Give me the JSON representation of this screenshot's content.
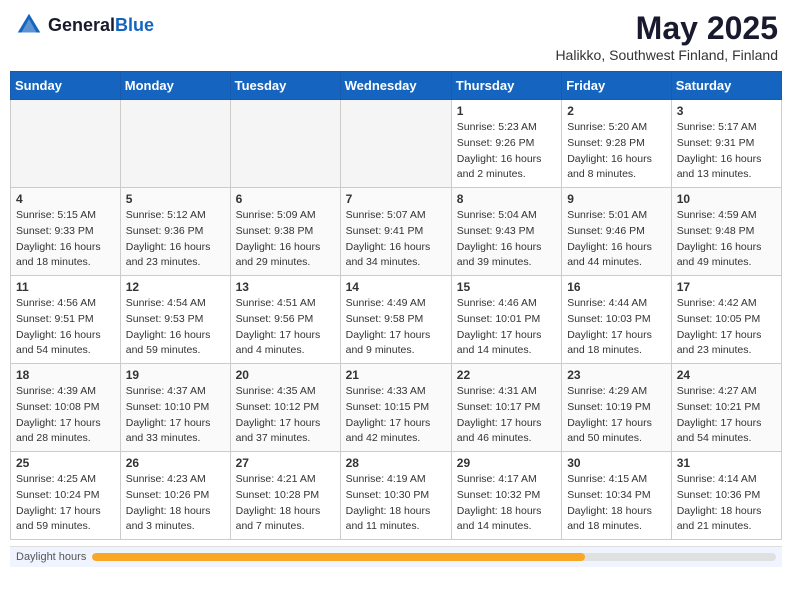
{
  "header": {
    "logo_general": "General",
    "logo_blue": "Blue",
    "month_title": "May 2025",
    "location": "Halikko, Southwest Finland, Finland"
  },
  "weekdays": [
    "Sunday",
    "Monday",
    "Tuesday",
    "Wednesday",
    "Thursday",
    "Friday",
    "Saturday"
  ],
  "weeks": [
    [
      {
        "day": "",
        "empty": true
      },
      {
        "day": "",
        "empty": true
      },
      {
        "day": "",
        "empty": true
      },
      {
        "day": "",
        "empty": true
      },
      {
        "day": "1",
        "sunrise": "5:23 AM",
        "sunset": "9:26 PM",
        "daylight": "16 hours and 2 minutes."
      },
      {
        "day": "2",
        "sunrise": "5:20 AM",
        "sunset": "9:28 PM",
        "daylight": "16 hours and 8 minutes."
      },
      {
        "day": "3",
        "sunrise": "5:17 AM",
        "sunset": "9:31 PM",
        "daylight": "16 hours and 13 minutes."
      }
    ],
    [
      {
        "day": "4",
        "sunrise": "5:15 AM",
        "sunset": "9:33 PM",
        "daylight": "16 hours and 18 minutes."
      },
      {
        "day": "5",
        "sunrise": "5:12 AM",
        "sunset": "9:36 PM",
        "daylight": "16 hours and 23 minutes."
      },
      {
        "day": "6",
        "sunrise": "5:09 AM",
        "sunset": "9:38 PM",
        "daylight": "16 hours and 29 minutes."
      },
      {
        "day": "7",
        "sunrise": "5:07 AM",
        "sunset": "9:41 PM",
        "daylight": "16 hours and 34 minutes."
      },
      {
        "day": "8",
        "sunrise": "5:04 AM",
        "sunset": "9:43 PM",
        "daylight": "16 hours and 39 minutes."
      },
      {
        "day": "9",
        "sunrise": "5:01 AM",
        "sunset": "9:46 PM",
        "daylight": "16 hours and 44 minutes."
      },
      {
        "day": "10",
        "sunrise": "4:59 AM",
        "sunset": "9:48 PM",
        "daylight": "16 hours and 49 minutes."
      }
    ],
    [
      {
        "day": "11",
        "sunrise": "4:56 AM",
        "sunset": "9:51 PM",
        "daylight": "16 hours and 54 minutes."
      },
      {
        "day": "12",
        "sunrise": "4:54 AM",
        "sunset": "9:53 PM",
        "daylight": "16 hours and 59 minutes."
      },
      {
        "day": "13",
        "sunrise": "4:51 AM",
        "sunset": "9:56 PM",
        "daylight": "17 hours and 4 minutes."
      },
      {
        "day": "14",
        "sunrise": "4:49 AM",
        "sunset": "9:58 PM",
        "daylight": "17 hours and 9 minutes."
      },
      {
        "day": "15",
        "sunrise": "4:46 AM",
        "sunset": "10:01 PM",
        "daylight": "17 hours and 14 minutes."
      },
      {
        "day": "16",
        "sunrise": "4:44 AM",
        "sunset": "10:03 PM",
        "daylight": "17 hours and 18 minutes."
      },
      {
        "day": "17",
        "sunrise": "4:42 AM",
        "sunset": "10:05 PM",
        "daylight": "17 hours and 23 minutes."
      }
    ],
    [
      {
        "day": "18",
        "sunrise": "4:39 AM",
        "sunset": "10:08 PM",
        "daylight": "17 hours and 28 minutes."
      },
      {
        "day": "19",
        "sunrise": "4:37 AM",
        "sunset": "10:10 PM",
        "daylight": "17 hours and 33 minutes."
      },
      {
        "day": "20",
        "sunrise": "4:35 AM",
        "sunset": "10:12 PM",
        "daylight": "17 hours and 37 minutes."
      },
      {
        "day": "21",
        "sunrise": "4:33 AM",
        "sunset": "10:15 PM",
        "daylight": "17 hours and 42 minutes."
      },
      {
        "day": "22",
        "sunrise": "4:31 AM",
        "sunset": "10:17 PM",
        "daylight": "17 hours and 46 minutes."
      },
      {
        "day": "23",
        "sunrise": "4:29 AM",
        "sunset": "10:19 PM",
        "daylight": "17 hours and 50 minutes."
      },
      {
        "day": "24",
        "sunrise": "4:27 AM",
        "sunset": "10:21 PM",
        "daylight": "17 hours and 54 minutes."
      }
    ],
    [
      {
        "day": "25",
        "sunrise": "4:25 AM",
        "sunset": "10:24 PM",
        "daylight": "17 hours and 59 minutes."
      },
      {
        "day": "26",
        "sunrise": "4:23 AM",
        "sunset": "10:26 PM",
        "daylight": "18 hours and 3 minutes."
      },
      {
        "day": "27",
        "sunrise": "4:21 AM",
        "sunset": "10:28 PM",
        "daylight": "18 hours and 7 minutes."
      },
      {
        "day": "28",
        "sunrise": "4:19 AM",
        "sunset": "10:30 PM",
        "daylight": "18 hours and 11 minutes."
      },
      {
        "day": "29",
        "sunrise": "4:17 AM",
        "sunset": "10:32 PM",
        "daylight": "18 hours and 14 minutes."
      },
      {
        "day": "30",
        "sunrise": "4:15 AM",
        "sunset": "10:34 PM",
        "daylight": "18 hours and 18 minutes."
      },
      {
        "day": "31",
        "sunrise": "4:14 AM",
        "sunset": "10:36 PM",
        "daylight": "18 hours and 21 minutes."
      }
    ]
  ],
  "daylight_footer": {
    "label": "Daylight hours",
    "bar_percent": 72
  }
}
